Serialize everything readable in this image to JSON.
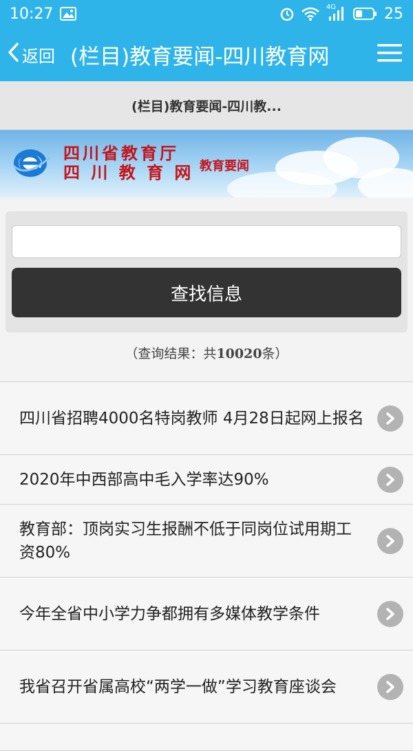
{
  "status_bar": {
    "time": "10:27",
    "network": "4G",
    "battery": "25",
    "icons": [
      "image-icon",
      "alarm-icon",
      "wifi-icon",
      "signal-icon",
      "battery-icon"
    ]
  },
  "app_bar": {
    "back_label": "返回",
    "title": "(栏目)教育要闻-四川教育网",
    "menu_icon": "hamburger-menu-icon"
  },
  "subtitle": "(栏目)教育要闻-四川教...",
  "banner": {
    "org_line1": "四川省教育厅",
    "org_line2": "四 川 教 育 网",
    "section": "教育要闻",
    "logo_icon": "e-logo-icon"
  },
  "search": {
    "input_value": "",
    "placeholder": "",
    "button_label": "查找信息"
  },
  "result_count": {
    "prefix": "（查询结果：共",
    "count": "10020",
    "suffix": "条）"
  },
  "news": [
    {
      "title": "四川省招聘4000名特岗教师 4月28日起网上报名"
    },
    {
      "title": "2020年中西部高中毛入学率达90%"
    },
    {
      "title": "教育部：顶岗实习生报酬不低于同岗位试用期工资80%"
    },
    {
      "title": "今年全省中小学力争都拥有多媒体教学条件"
    },
    {
      "title": "我省召开省属高校“两学一做”学习教育座谈会"
    }
  ],
  "colors": {
    "header_bg": "#2fb4ea",
    "search_button_bg": "#333333",
    "banner_text": "#c4141b"
  }
}
